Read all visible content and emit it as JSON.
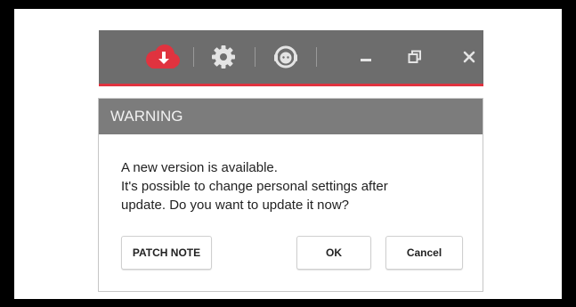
{
  "titlebar": {
    "icons": [
      "cloud-download-icon",
      "gear-icon",
      "support-agent-icon",
      "minimize-icon",
      "restore-icon",
      "close-icon"
    ],
    "accent_color": "#e0333f",
    "background_color": "#6d6d6d"
  },
  "dialog": {
    "title": "WARNING",
    "message_lines": [
      "A new version is available.",
      "It's possible to change personal settings after",
      "update. Do you want to update it now?"
    ],
    "buttons": {
      "patch_note": "PATCH NOTE",
      "ok": "OK",
      "cancel": "Cancel"
    }
  }
}
